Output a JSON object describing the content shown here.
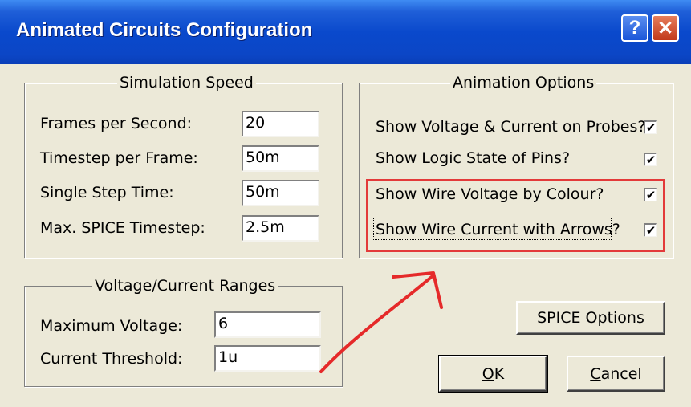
{
  "window": {
    "title": "Animated Circuits Configuration",
    "help_glyph": "?",
    "close_glyph": "✕"
  },
  "simulation_speed": {
    "legend": "Simulation Speed",
    "rows": [
      {
        "label": "Frames per Second:",
        "value": "20"
      },
      {
        "label": "Timestep per Frame:",
        "value": "50m"
      },
      {
        "label": "Single Step Time:",
        "value": "50m"
      },
      {
        "label": "Max. SPICE Timestep:",
        "value": "2.5m"
      }
    ]
  },
  "ranges": {
    "legend": "Voltage/Current Ranges",
    "rows": [
      {
        "label": "Maximum Voltage:",
        "value": "6"
      },
      {
        "label": "Current Threshold:",
        "value": "1u"
      }
    ]
  },
  "animation_options": {
    "legend": "Animation Options",
    "items": [
      {
        "label": "Show Voltage & Current on Probes?",
        "checked": true,
        "mark": "✔"
      },
      {
        "label": "Show Logic State of Pins?",
        "checked": true,
        "mark": "✔"
      },
      {
        "label": "Show Wire Voltage by Colour?",
        "checked": true,
        "mark": "✔"
      },
      {
        "label": "Show Wire Current with Arrows?",
        "checked": true,
        "mark": "✔"
      }
    ]
  },
  "buttons": {
    "spice_pre": "SP",
    "spice_accel": "I",
    "spice_post": "CE Options",
    "ok_accel": "O",
    "ok_post": "K",
    "cancel_accel": "C",
    "cancel_post": "ancel"
  },
  "annotation": {
    "highlight_color": "#e33a3a"
  }
}
